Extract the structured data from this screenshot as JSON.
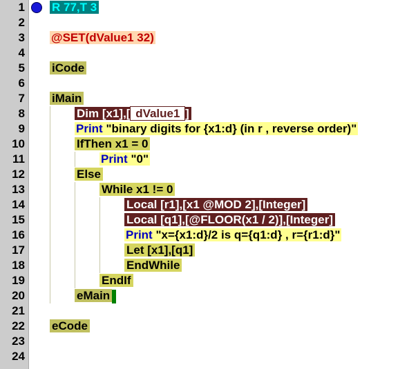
{
  "lines": [
    {
      "n": "1"
    },
    {
      "n": "2"
    },
    {
      "n": "3"
    },
    {
      "n": "4"
    },
    {
      "n": "5"
    },
    {
      "n": "6"
    },
    {
      "n": "7"
    },
    {
      "n": "8"
    },
    {
      "n": "9"
    },
    {
      "n": "10"
    },
    {
      "n": "11"
    },
    {
      "n": "12"
    },
    {
      "n": "13"
    },
    {
      "n": "14"
    },
    {
      "n": "15"
    },
    {
      "n": "16"
    },
    {
      "n": "17"
    },
    {
      "n": "18"
    },
    {
      "n": "19"
    },
    {
      "n": "20"
    },
    {
      "n": "21"
    },
    {
      "n": "22"
    },
    {
      "n": "23"
    },
    {
      "n": "24"
    }
  ],
  "status": "R 77,T 3",
  "set_cmd": "@SET(dValue1 32)",
  "icode": "iCode",
  "imain": "iMain",
  "dim_kw": "Dim",
  "dim_args": " [x1],[",
  "dim_const": " dValue1 ",
  "dim_close": "]",
  "print1_kw": "Print ",
  "print1_str": "\"binary digits for {x1:d} (in r , reverse order)\"",
  "ifthen": "IfThen x1 = 0",
  "print0_kw": "Print ",
  "print0_str": "\"0\"",
  "else": "Else",
  "while": "While x1 != 0",
  "local1": "Local [r1],[x1 @MOD 2],[Integer]",
  "local2": "Local [q1],[@FLOOR(x1 / 2)],[Integer]",
  "print2_kw": "Print ",
  "print2_str": "\"x={x1:d}/2 is q={q1:d} , r={r1:d}\"",
  "let": "Let [x1],[q1]",
  "endwhile": "EndWhile",
  "endif": "EndIf",
  "emain": "eMain",
  "ecode": "eCode"
}
